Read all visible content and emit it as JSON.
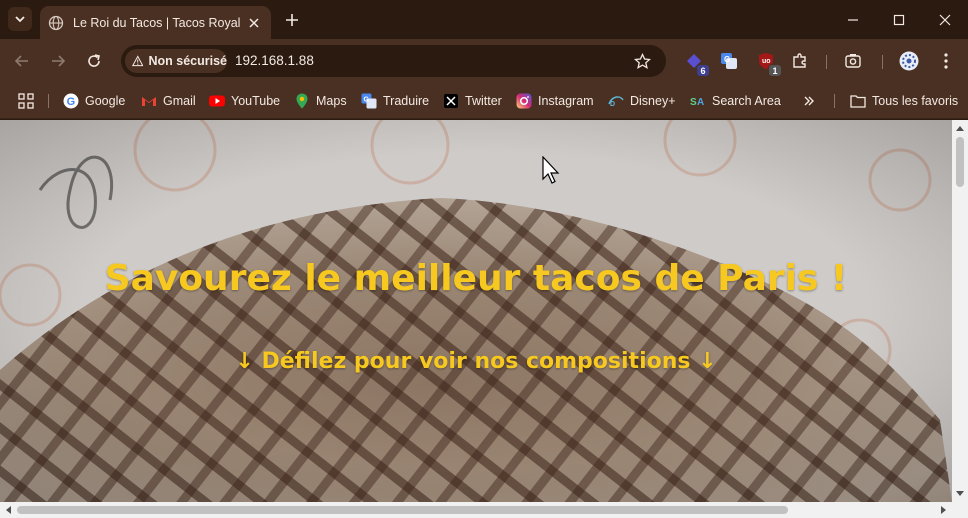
{
  "browser": {
    "tab": {
      "title": "Le Roi du Tacos | Tacos Royal"
    },
    "address": {
      "security_label": "Non sécurisé",
      "url": "192.168.1.88"
    },
    "extensions": [
      {
        "name": "ext-1",
        "badge": "6"
      },
      {
        "name": "google-translate",
        "badge": ""
      },
      {
        "name": "ublock",
        "badge": "1"
      }
    ],
    "bookmarks": [
      {
        "label": "Google",
        "icon": "google-icon"
      },
      {
        "label": "Gmail",
        "icon": "gmail-icon"
      },
      {
        "label": "YouTube",
        "icon": "youtube-icon"
      },
      {
        "label": "Maps",
        "icon": "maps-icon"
      },
      {
        "label": "Traduire",
        "icon": "translate-icon"
      },
      {
        "label": "Twitter",
        "icon": "x-icon"
      },
      {
        "label": "Instagram",
        "icon": "instagram-icon"
      },
      {
        "label": "Disney+",
        "icon": "disney-icon"
      },
      {
        "label": "Search Area",
        "icon": "search-area-icon"
      }
    ],
    "all_bookmarks_label": "Tous les favoris",
    "colors": {
      "frame": "#2b1a10",
      "toolbar": "#4a3022",
      "text": "#f3e9e3"
    }
  },
  "page": {
    "hero_title": "Savourez le meilleur tacos de Paris !",
    "hero_subtitle": "↓ Défilez pour voir nos compositions ↓",
    "accent": "#f6c820"
  }
}
